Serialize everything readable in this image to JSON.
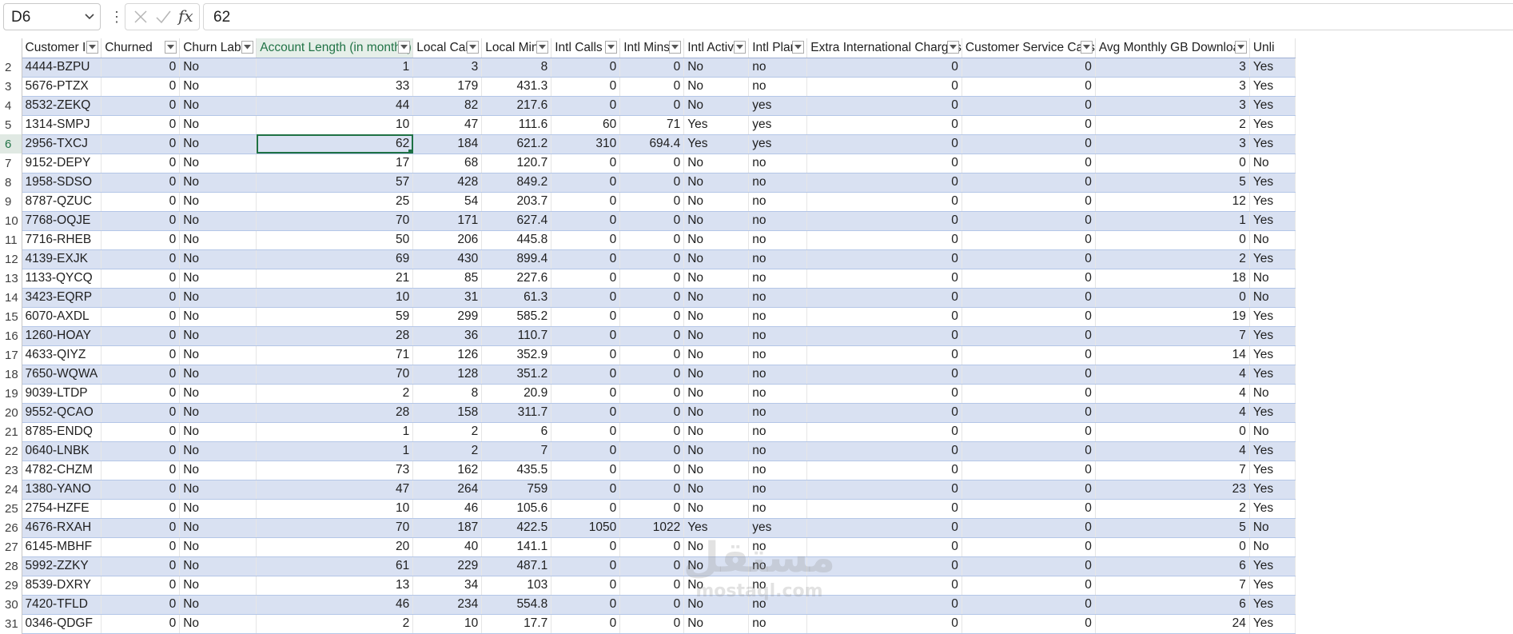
{
  "name_box": {
    "value": "D6"
  },
  "formula_bar": {
    "value": "62",
    "more_glyph": "⋮"
  },
  "columns": [
    "Customer ID",
    "Churned",
    "Churn Label",
    "Account Length (in months)",
    "Local Calls",
    "Local Mins",
    "Intl Calls",
    "Intl Mins",
    "Intl Active",
    "Intl Plan",
    "Extra International Charges",
    "Customer Service Calls",
    "Avg Monthly GB Download",
    "Unli"
  ],
  "selected_column_index": 3,
  "active_cell": {
    "row": "6",
    "col_index": 3
  },
  "rows": [
    {
      "n": "2",
      "cells": [
        "4444-BZPU",
        "0",
        "No",
        "1",
        "3",
        "8",
        "0",
        "0",
        "No",
        "no",
        "0",
        "0",
        "3",
        "Yes"
      ]
    },
    {
      "n": "3",
      "cells": [
        "5676-PTZX",
        "0",
        "No",
        "33",
        "179",
        "431.3",
        "0",
        "0",
        "No",
        "no",
        "0",
        "0",
        "3",
        "Yes"
      ]
    },
    {
      "n": "4",
      "cells": [
        "8532-ZEKQ",
        "0",
        "No",
        "44",
        "82",
        "217.6",
        "0",
        "0",
        "No",
        "yes",
        "0",
        "0",
        "3",
        "Yes"
      ]
    },
    {
      "n": "5",
      "cells": [
        "1314-SMPJ",
        "0",
        "No",
        "10",
        "47",
        "111.6",
        "60",
        "71",
        "Yes",
        "yes",
        "0",
        "0",
        "2",
        "Yes"
      ]
    },
    {
      "n": "6",
      "cells": [
        "2956-TXCJ",
        "0",
        "No",
        "62",
        "184",
        "621.2",
        "310",
        "694.4",
        "Yes",
        "yes",
        "0",
        "0",
        "3",
        "Yes"
      ]
    },
    {
      "n": "7",
      "cells": [
        "9152-DEPY",
        "0",
        "No",
        "17",
        "68",
        "120.7",
        "0",
        "0",
        "No",
        "no",
        "0",
        "0",
        "0",
        "No"
      ]
    },
    {
      "n": "8",
      "cells": [
        "1958-SDSO",
        "0",
        "No",
        "57",
        "428",
        "849.2",
        "0",
        "0",
        "No",
        "no",
        "0",
        "0",
        "5",
        "Yes"
      ]
    },
    {
      "n": "9",
      "cells": [
        "8787-QZUC",
        "0",
        "No",
        "25",
        "54",
        "203.7",
        "0",
        "0",
        "No",
        "no",
        "0",
        "0",
        "12",
        "Yes"
      ]
    },
    {
      "n": "10",
      "cells": [
        "7768-OQJE",
        "0",
        "No",
        "70",
        "171",
        "627.4",
        "0",
        "0",
        "No",
        "no",
        "0",
        "0",
        "1",
        "Yes"
      ]
    },
    {
      "n": "11",
      "cells": [
        "7716-RHEB",
        "0",
        "No",
        "50",
        "206",
        "445.8",
        "0",
        "0",
        "No",
        "no",
        "0",
        "0",
        "0",
        "No"
      ]
    },
    {
      "n": "12",
      "cells": [
        "4139-EXJK",
        "0",
        "No",
        "69",
        "430",
        "899.4",
        "0",
        "0",
        "No",
        "no",
        "0",
        "0",
        "2",
        "Yes"
      ]
    },
    {
      "n": "13",
      "cells": [
        "1133-QYCQ",
        "0",
        "No",
        "21",
        "85",
        "227.6",
        "0",
        "0",
        "No",
        "no",
        "0",
        "0",
        "18",
        "No"
      ]
    },
    {
      "n": "14",
      "cells": [
        "3423-EQRP",
        "0",
        "No",
        "10",
        "31",
        "61.3",
        "0",
        "0",
        "No",
        "no",
        "0",
        "0",
        "0",
        "No"
      ]
    },
    {
      "n": "15",
      "cells": [
        "6070-AXDL",
        "0",
        "No",
        "59",
        "299",
        "585.2",
        "0",
        "0",
        "No",
        "no",
        "0",
        "0",
        "19",
        "Yes"
      ]
    },
    {
      "n": "16",
      "cells": [
        "1260-HOAY",
        "0",
        "No",
        "28",
        "36",
        "110.7",
        "0",
        "0",
        "No",
        "no",
        "0",
        "0",
        "7",
        "Yes"
      ]
    },
    {
      "n": "17",
      "cells": [
        "4633-QIYZ",
        "0",
        "No",
        "71",
        "126",
        "352.9",
        "0",
        "0",
        "No",
        "no",
        "0",
        "0",
        "14",
        "Yes"
      ]
    },
    {
      "n": "18",
      "cells": [
        "7650-WQWA",
        "0",
        "No",
        "70",
        "128",
        "351.2",
        "0",
        "0",
        "No",
        "no",
        "0",
        "0",
        "4",
        "Yes"
      ]
    },
    {
      "n": "19",
      "cells": [
        "9039-LTDP",
        "0",
        "No",
        "2",
        "8",
        "20.9",
        "0",
        "0",
        "No",
        "no",
        "0",
        "0",
        "4",
        "No"
      ]
    },
    {
      "n": "20",
      "cells": [
        "9552-QCAO",
        "0",
        "No",
        "28",
        "158",
        "311.7",
        "0",
        "0",
        "No",
        "no",
        "0",
        "0",
        "4",
        "Yes"
      ]
    },
    {
      "n": "21",
      "cells": [
        "8785-ENDQ",
        "0",
        "No",
        "1",
        "2",
        "6",
        "0",
        "0",
        "No",
        "no",
        "0",
        "0",
        "0",
        "No"
      ]
    },
    {
      "n": "22",
      "cells": [
        "0640-LNBK",
        "0",
        "No",
        "1",
        "2",
        "7",
        "0",
        "0",
        "No",
        "no",
        "0",
        "0",
        "4",
        "Yes"
      ]
    },
    {
      "n": "23",
      "cells": [
        "4782-CHZM",
        "0",
        "No",
        "73",
        "162",
        "435.5",
        "0",
        "0",
        "No",
        "no",
        "0",
        "0",
        "7",
        "Yes"
      ]
    },
    {
      "n": "24",
      "cells": [
        "1380-YANO",
        "0",
        "No",
        "47",
        "264",
        "759",
        "0",
        "0",
        "No",
        "no",
        "0",
        "0",
        "23",
        "Yes"
      ]
    },
    {
      "n": "25",
      "cells": [
        "2754-HZFE",
        "0",
        "No",
        "10",
        "46",
        "105.6",
        "0",
        "0",
        "No",
        "no",
        "0",
        "0",
        "2",
        "Yes"
      ]
    },
    {
      "n": "26",
      "cells": [
        "4676-RXAH",
        "0",
        "No",
        "70",
        "187",
        "422.5",
        "1050",
        "1022",
        "Yes",
        "yes",
        "0",
        "0",
        "5",
        "No"
      ]
    },
    {
      "n": "27",
      "cells": [
        "6145-MBHF",
        "0",
        "No",
        "20",
        "40",
        "141.1",
        "0",
        "0",
        "No",
        "no",
        "0",
        "0",
        "0",
        "No"
      ]
    },
    {
      "n": "28",
      "cells": [
        "5992-ZZKY",
        "0",
        "No",
        "61",
        "229",
        "487.1",
        "0",
        "0",
        "No",
        "no",
        "0",
        "0",
        "6",
        "Yes"
      ]
    },
    {
      "n": "29",
      "cells": [
        "8539-DXRY",
        "0",
        "No",
        "13",
        "34",
        "103",
        "0",
        "0",
        "No",
        "no",
        "0",
        "0",
        "7",
        "Yes"
      ]
    },
    {
      "n": "30",
      "cells": [
        "7420-TFLD",
        "0",
        "No",
        "46",
        "234",
        "554.8",
        "0",
        "0",
        "No",
        "no",
        "0",
        "0",
        "6",
        "Yes"
      ]
    },
    {
      "n": "31",
      "cells": [
        "0346-QDGF",
        "0",
        "No",
        "2",
        "10",
        "17.7",
        "0",
        "0",
        "No",
        "no",
        "0",
        "0",
        "24",
        "Yes"
      ]
    }
  ],
  "watermark": {
    "arabic": "مستقل",
    "latin": "mostaql.com"
  },
  "colors": {
    "band": "#d9e1f2",
    "selection": "#1e7145",
    "header_selected": "#217346"
  }
}
